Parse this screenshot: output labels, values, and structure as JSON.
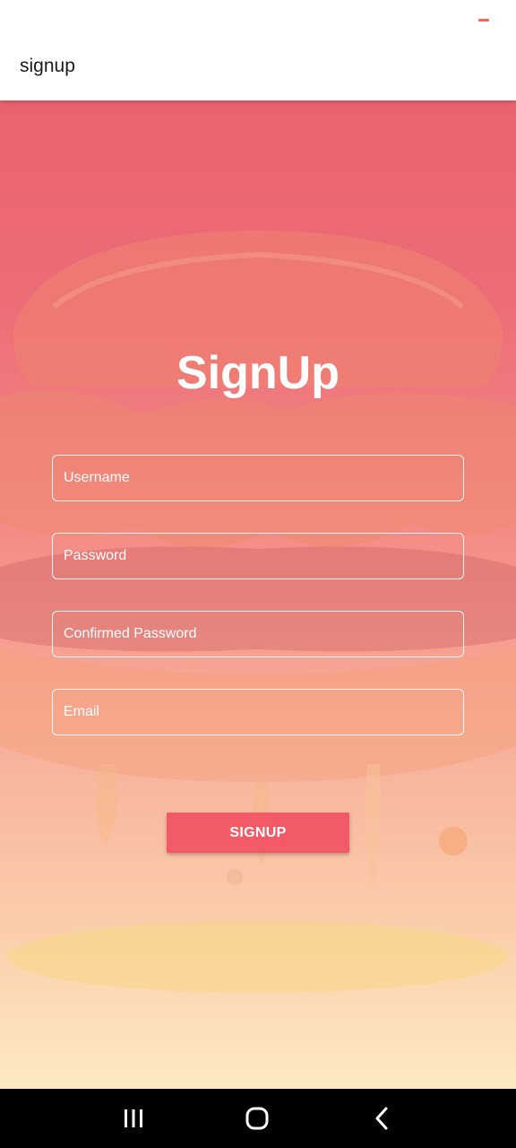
{
  "app_bar": {
    "title": "signup"
  },
  "form": {
    "heading": "SignUp",
    "fields": [
      {
        "placeholder": "Username",
        "value": ""
      },
      {
        "placeholder": "Password",
        "value": ""
      },
      {
        "placeholder": "Confirmed Password",
        "value": ""
      },
      {
        "placeholder": "Email",
        "value": ""
      }
    ],
    "submit_label": "SIGNUP"
  },
  "colors": {
    "accent": "#f15a66",
    "menu_dash": "#f06a50",
    "background_top": "#e96270",
    "background_bottom": "#fde9c2"
  },
  "nav_bar": {
    "buttons": [
      "recents-icon",
      "home-icon",
      "back-icon"
    ]
  }
}
